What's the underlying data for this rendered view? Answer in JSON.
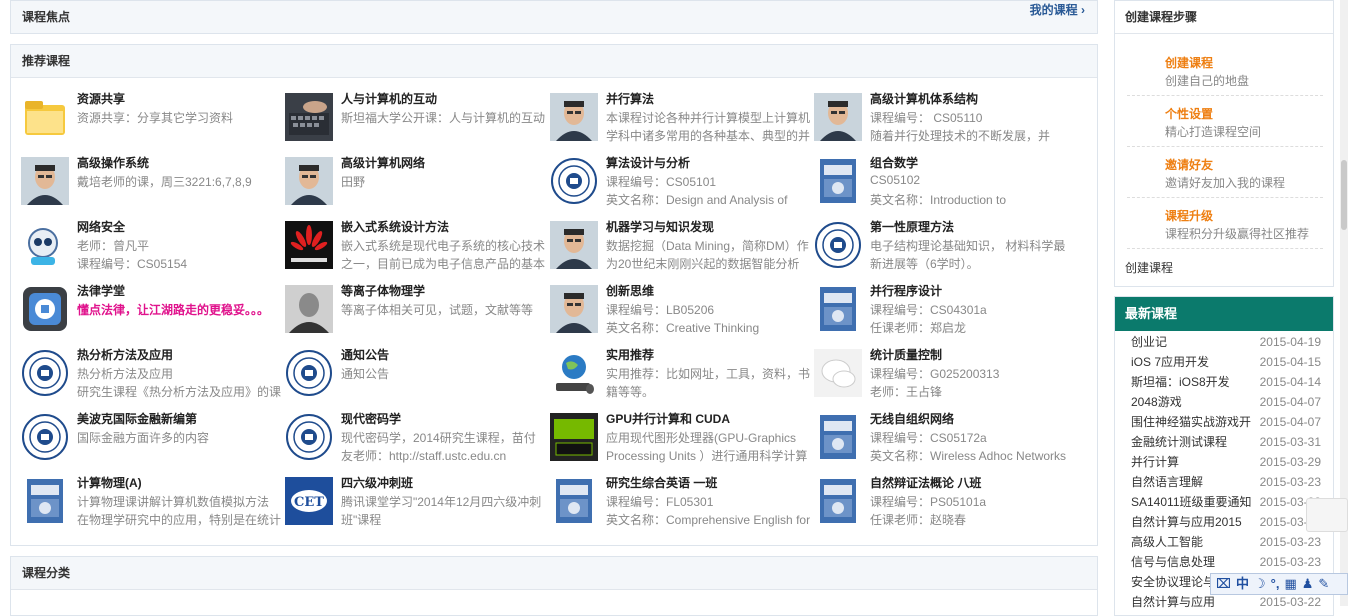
{
  "focus": {
    "title": "课程焦点",
    "my_courses": "我的课程 ›"
  },
  "recommend": {
    "title": "推荐课程"
  },
  "category": {
    "title": "课程分类"
  },
  "courses": [
    {
      "title": "资源共享",
      "l1": "资源共享：分享其它学习资料",
      "l2": "",
      "thumb": "folder-icon"
    },
    {
      "title": "人与计算机的互动",
      "l1": "斯坦福大学公开课：人与计算机的互动",
      "l2": "",
      "thumb": "keyboard-photo"
    },
    {
      "title": "并行算法",
      "l1": "本课程讨论各种并行计算模型上计算机",
      "l2": "学科中诸多常用的各种基本、典型的并",
      "thumb": "teacher-photo"
    },
    {
      "title": "高级计算机体系结构",
      "l1": "课程编号：        CS05110",
      "l2": "        随着并行处理技术的不断发展，并",
      "thumb": "teacher-photo"
    },
    {
      "title": "高级操作系统",
      "l1": "戴培老师的课，周三3221:6,7,8,9",
      "l2": "",
      "thumb": "teacher-photo"
    },
    {
      "title": "高级计算机网络",
      "l1": "田野",
      "l2": "",
      "thumb": "teacher-photo"
    },
    {
      "title": "算法设计与分析",
      "l1": "课程编号：CS05101",
      "l2": "英文名称：Design and Analysis of",
      "thumb": "ustc-logo"
    },
    {
      "title": "组合数学",
      "l1": "CS05102",
      "l2": "英文名称：Introduction to",
      "thumb": "book-cover"
    },
    {
      "title": "网络安全",
      "l1": "老师：曾凡平",
      "l2": "课程编号：CS05154",
      "thumb": "robot-icon"
    },
    {
      "title": "嵌入式系统设计方法",
      "l1": "嵌入式系统是现代电子系统的核心技术",
      "l2": "之一，目前已成为电子信息产品的基本",
      "thumb": "huawei-logo"
    },
    {
      "title": "机器学习与知识发现",
      "l1": "数据挖掘（Data Mining，简称DM）作",
      "l2": "为20世纪末刚刚兴起的数据智能分析",
      "thumb": "teacher-photo"
    },
    {
      "title": "第一性原理方法",
      "l1": "电子结构理论基础知识， 材料科学最",
      "l2": "新进展等（6学时）。",
      "thumb": "ustc-logo"
    },
    {
      "title": "法律学堂",
      "l1": "懂点法律，让江湖路走的更稳妥。。。",
      "l2": "",
      "thumb": "law-icon",
      "pink": true
    },
    {
      "title": "等离子体物理学",
      "l1": "等离子体相关可见，试题，文献等等",
      "l2": "",
      "thumb": "bw-photo"
    },
    {
      "title": "创新思维",
      "l1": "课程编号：LB05206",
      "l2": "英文名称：Creative Thinking",
      "thumb": "teacher-photo"
    },
    {
      "title": "并行程序设计",
      "l1": "课程编号：CS04301a",
      "l2": "任课老师：郑启龙",
      "thumb": "book-cover"
    },
    {
      "title": "热分析方法及应用",
      "l1": "热分析方法及应用",
      "l2": "研究生课程《热分析方法及应用》的课",
      "thumb": "ustc-logo"
    },
    {
      "title": "通知公告",
      "l1": "通知公告",
      "l2": "",
      "thumb": "ustc-logo"
    },
    {
      "title": "实用推荐",
      "l1": "实用推荐：比如网址，工具，资料，书",
      "l2": "籍等等。",
      "thumb": "globe-icon"
    },
    {
      "title": "统计质量控制",
      "l1": "课程编号：G025200313",
      "l2": "老师：王占锋",
      "thumb": "chat-icon"
    },
    {
      "title": "美波克国际金融新编第",
      "l1": "国际金融方面许多的内容",
      "l2": "",
      "thumb": "ustc-logo"
    },
    {
      "title": "现代密码学",
      "l1": "现代密码学，2014研究生课程，苗付",
      "l2": "友老师：http://staff.ustc.edu.cn",
      "thumb": "ustc-logo"
    },
    {
      "title": "GPU并行计算和 CUDA",
      "l1": "应用现代图形处理器(GPU-Graphics",
      "l2": "Processing Units ）进行通用科学计算",
      "thumb": "nvidia-logo"
    },
    {
      "title": "无线自组织网络",
      "l1": "课程编号：CS05172a",
      "l2": "英文名称：Wireless Adhoc Networks",
      "thumb": "book-cover"
    },
    {
      "title": "计算物理(A)",
      "l1": "计算物理课讲解计算机数值模拟方法",
      "l2": "在物理学研究中的应用，特别是在统计",
      "thumb": "book-cover"
    },
    {
      "title": "四六级冲刺班",
      "l1": "腾讯课堂学习\"2014年12月四六级冲刺",
      "l2": "班\"课程",
      "thumb": "cet-logo"
    },
    {
      "title": "研究生综合英语 一班",
      "l1": "课程编号：FL05301",
      "l2": "英文名称：Comprehensive English for",
      "thumb": "book-cover"
    },
    {
      "title": "自然辩证法概论 八班",
      "l1": "课程编号：PS05101a",
      "l2": "任课老师：赵晓春",
      "thumb": "book-cover"
    }
  ],
  "steps": {
    "title": "创建课程步骤",
    "items": [
      {
        "title": "创建课程",
        "desc": "创建自己的地盘"
      },
      {
        "title": "个性设置",
        "desc": "精心打造课程空间"
      },
      {
        "title": "邀请好友",
        "desc": "邀请好友加入我的课程"
      },
      {
        "title": "课程升级",
        "desc": "课程积分升级赢得社区推荐"
      }
    ],
    "create_link": "创建课程"
  },
  "latest": {
    "title": "最新课程",
    "items": [
      {
        "name": "创业记",
        "date": "2015-04-19"
      },
      {
        "name": "iOS 7应用开发",
        "date": "2015-04-15"
      },
      {
        "name": "斯坦福：iOS8开发",
        "date": "2015-04-14"
      },
      {
        "name": "2048游戏",
        "date": "2015-04-07"
      },
      {
        "name": "围住神经猫实战游戏开",
        "date": "2015-04-07"
      },
      {
        "name": "金融统计测试课程",
        "date": "2015-03-31"
      },
      {
        "name": "并行计算",
        "date": "2015-03-29"
      },
      {
        "name": "自然语言理解",
        "date": "2015-03-23"
      },
      {
        "name": "SA14011班级重要通知",
        "date": "2015-03-23"
      },
      {
        "name": "自然计算与应用2015",
        "date": "2015-03-23"
      },
      {
        "name": "高级人工智能",
        "date": "2015-03-23"
      },
      {
        "name": "信号与信息处理",
        "date": "2015-03-23"
      },
      {
        "name": "安全协议理论与",
        "date": "2015-03-23"
      },
      {
        "name": "自然计算与应用",
        "date": "2015-03-22"
      }
    ]
  },
  "ime": {
    "label": "中"
  },
  "colors": {
    "accent_green": "#0b7a6c",
    "step_orange": "#ee7f12",
    "link_blue": "#2a5a96",
    "pink": "#e0128c"
  }
}
